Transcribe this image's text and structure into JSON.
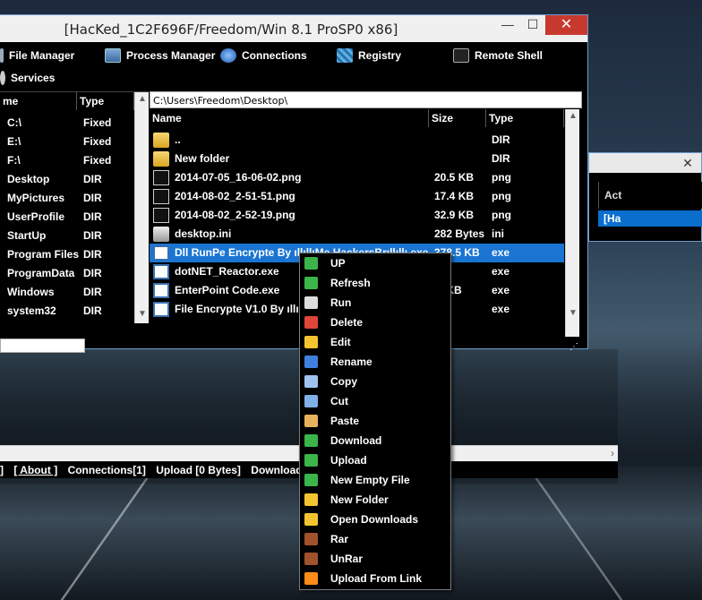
{
  "window": {
    "title": "[HacKed_1C2F696F/Freedom/Win 8.1 ProSP0 x86]",
    "minimize": "—",
    "maximize": "☐",
    "close": "✕"
  },
  "menu": {
    "file_manager": "File Manager",
    "process_manager": "Process Manager",
    "connections": "Connections",
    "registry": "Registry",
    "remote_shell": "Remote Shell",
    "services": "Services"
  },
  "tree": {
    "col_name": "me",
    "col_type": "Type",
    "items": [
      {
        "name": "C:\\",
        "type": "Fixed",
        "kind": "drive"
      },
      {
        "name": "E:\\",
        "type": "Fixed",
        "kind": "drive"
      },
      {
        "name": "F:\\",
        "type": "Fixed",
        "kind": "drive"
      },
      {
        "name": "Desktop",
        "type": "DIR",
        "kind": "folder"
      },
      {
        "name": "MyPictures",
        "type": "DIR",
        "kind": "folder"
      },
      {
        "name": "UserProfile",
        "type": "DIR",
        "kind": "folder"
      },
      {
        "name": "StartUp",
        "type": "DIR",
        "kind": "folder"
      },
      {
        "name": "Program Files",
        "type": "DIR",
        "kind": "folder"
      },
      {
        "name": "ProgramData",
        "type": "DIR",
        "kind": "folder"
      },
      {
        "name": "Windows",
        "type": "DIR",
        "kind": "folder"
      },
      {
        "name": "system32",
        "type": "DIR",
        "kind": "folder"
      }
    ]
  },
  "path": "C:\\Users\\Freedom\\Desktop\\",
  "files": {
    "col_name": "Name",
    "col_size": "Size",
    "col_type": "Type",
    "rows": [
      {
        "name": "..",
        "size": "",
        "type": "DIR",
        "icon": "folder-icon"
      },
      {
        "name": "New folder",
        "size": "",
        "type": "DIR",
        "icon": "folder-icon"
      },
      {
        "name": "2014-07-05_16-06-02.png",
        "size": "20.5 KB",
        "type": "png",
        "icon": "image-icon"
      },
      {
        "name": "2014-08-02_2-51-51.png",
        "size": "17.4 KB",
        "type": "png",
        "icon": "image-icon"
      },
      {
        "name": "2014-08-02_2-52-19.png",
        "size": "32.9 KB",
        "type": "png",
        "icon": "image-icon"
      },
      {
        "name": "desktop.ini",
        "size": "282 Bytes",
        "type": "ini",
        "icon": "settings-file-icon"
      },
      {
        "name": "Dll RunPe Encrypte By ıllıllıMe HackersBrıllıllı.exe",
        "size": "378.5 KB",
        "type": "exe",
        "icon": "exe-icon"
      },
      {
        "name": "dotNET_Reactor.exe",
        "size": "MB",
        "type": "exe",
        "icon": "exe-icon"
      },
      {
        "name": "EnterPoint Code.exe",
        "size": ".5 KB",
        "type": "exe",
        "icon": "exe-icon"
      },
      {
        "name": "File Encrypte V1.0 By ıllıllı",
        "size": "MB",
        "type": "exe",
        "icon": "exe-icon"
      }
    ]
  },
  "statusbar": {
    "about": "[ About ]",
    "connections": "Connections[1]",
    "upload": "Upload [0 Bytes]",
    "download": "Download [0 By"
  },
  "window2": {
    "header": "Act",
    "selected": "[Ha"
  },
  "context_menu": [
    {
      "label": "UP",
      "icon": "up-arrow-icon",
      "color": "#3bb54a"
    },
    {
      "label": "Refresh",
      "icon": "refresh-icon",
      "color": "#3bb54a"
    },
    {
      "label": "Run",
      "icon": "run-icon",
      "color": "#dddddd"
    },
    {
      "label": "Delete",
      "icon": "delete-icon",
      "color": "#e0453a"
    },
    {
      "label": "Edit",
      "icon": "edit-icon",
      "color": "#f4c430"
    },
    {
      "label": "Rename",
      "icon": "rename-icon",
      "color": "#3f7fe0"
    },
    {
      "label": "Copy",
      "icon": "copy-icon",
      "color": "#9ec3f0"
    },
    {
      "label": "Cut",
      "icon": "cut-icon",
      "color": "#7fb0e8"
    },
    {
      "label": "Paste",
      "icon": "paste-icon",
      "color": "#e6b25c"
    },
    {
      "label": "Download",
      "icon": "download-icon",
      "color": "#3bb54a"
    },
    {
      "label": "Upload",
      "icon": "upload-icon",
      "color": "#3bb54a"
    },
    {
      "label": "New Empty File",
      "icon": "new-file-icon",
      "color": "#3bb54a"
    },
    {
      "label": "New Folder",
      "icon": "new-folder-icon",
      "color": "#f4c430"
    },
    {
      "label": "Open Downloads",
      "icon": "open-downloads-icon",
      "color": "#f4c430"
    },
    {
      "label": "Rar",
      "icon": "rar-icon",
      "color": "#a0522d"
    },
    {
      "label": "UnRar",
      "icon": "unrar-icon",
      "color": "#a0522d"
    },
    {
      "label": "Upload From Link",
      "icon": "upload-link-icon",
      "color": "#ff8c1a"
    }
  ]
}
